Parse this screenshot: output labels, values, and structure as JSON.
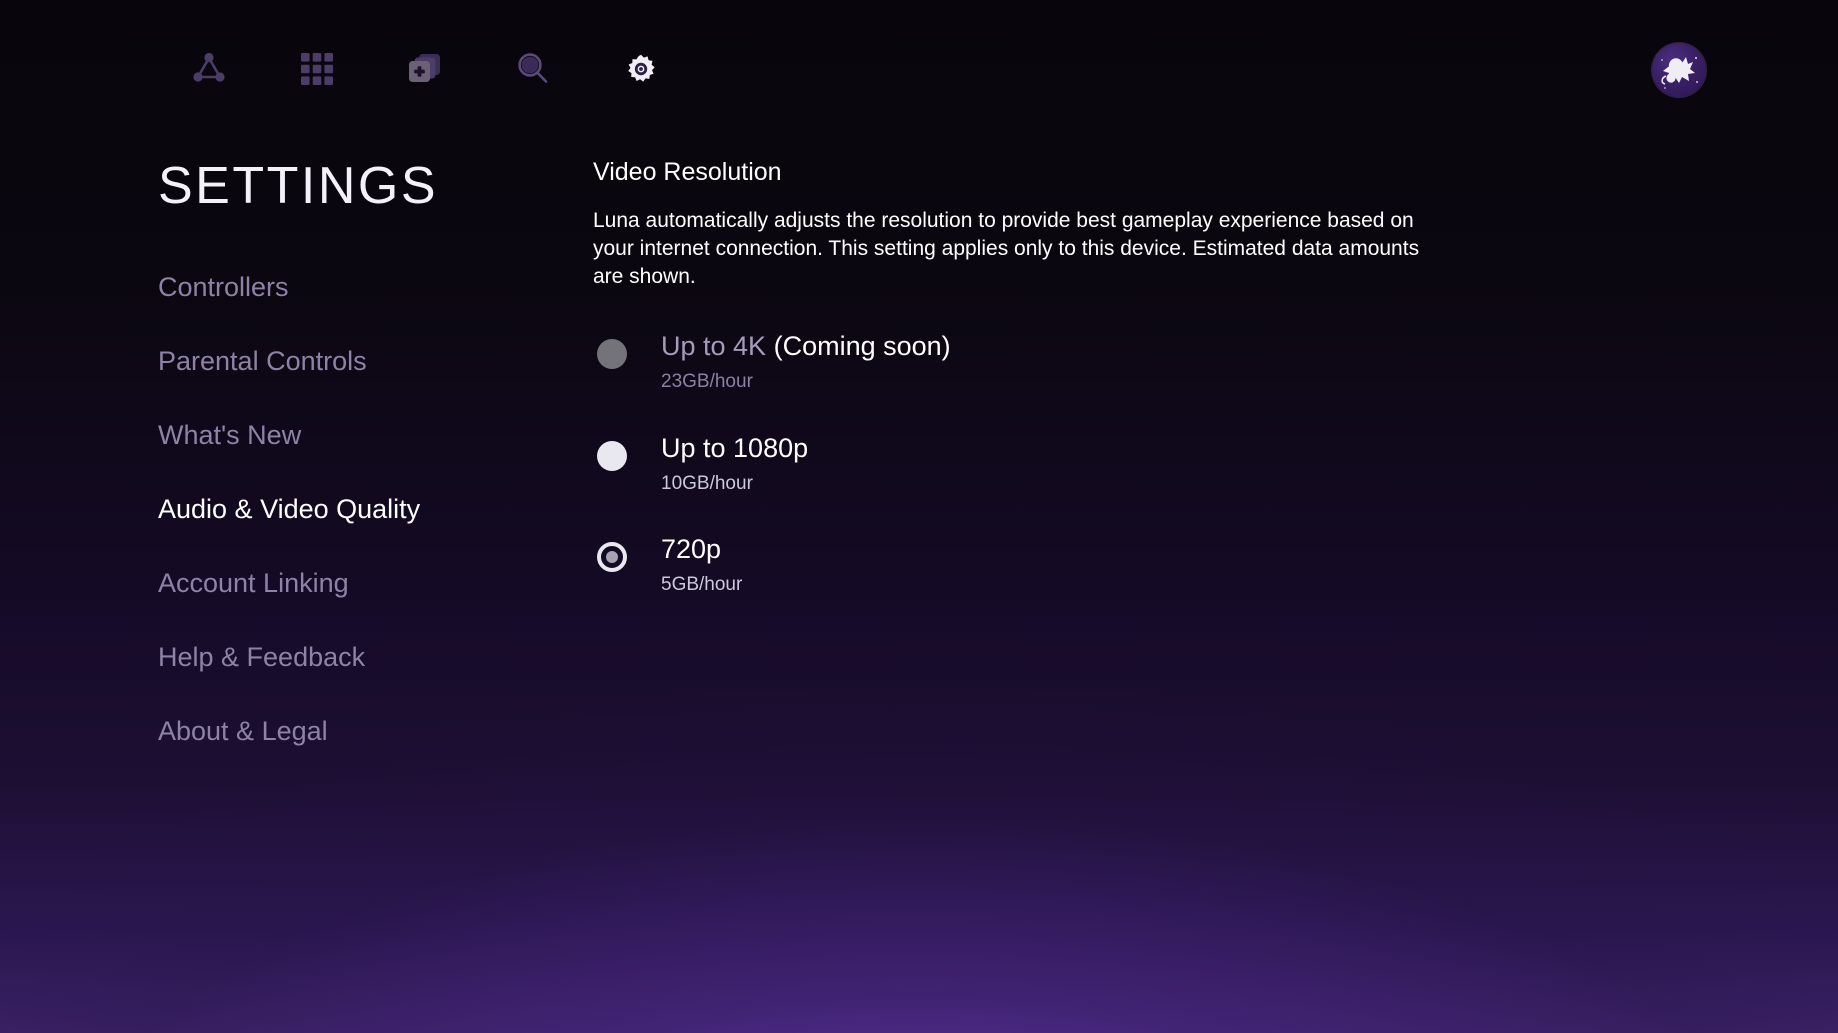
{
  "topnav": {
    "items": [
      {
        "name": "luna-home-icon",
        "label": "Luna Home"
      },
      {
        "name": "grid-library-icon",
        "label": "Game Library"
      },
      {
        "name": "add-to-library-icon",
        "label": "My Collection"
      },
      {
        "name": "search-icon",
        "label": "Search"
      },
      {
        "name": "gear-icon",
        "label": "Settings",
        "active": true
      }
    ],
    "avatar_label": "Profile"
  },
  "sidebar": {
    "title": "SETTINGS",
    "items": [
      {
        "label": "Controllers",
        "active": false
      },
      {
        "label": "Parental Controls",
        "active": false
      },
      {
        "label": "What's New",
        "active": false
      },
      {
        "label": "Audio & Video Quality",
        "active": true
      },
      {
        "label": "Account Linking",
        "active": false
      },
      {
        "label": "Help & Feedback",
        "active": false
      },
      {
        "label": "About & Legal",
        "active": false
      }
    ]
  },
  "main": {
    "section_title": "Video Resolution",
    "section_desc": "Luna automatically adjusts the resolution to provide best gameplay experience based on your internet connection. This setting applies only to this device. Estimated data amounts are shown.",
    "options": [
      {
        "label": "Up to 4K",
        "note": "(Coming soon)",
        "data_rate": "23GB/hour",
        "state": "disabled"
      },
      {
        "label": "Up to 1080p",
        "note": "",
        "data_rate": "10GB/hour",
        "state": "unselected"
      },
      {
        "label": "720p",
        "note": "",
        "data_rate": "5GB/hour",
        "state": "selected"
      }
    ]
  },
  "colors": {
    "accent_purple": "#3b2266",
    "icon_purple": "#4a3a66",
    "active_white": "#ffffff",
    "muted_text": "#8e82a6"
  }
}
